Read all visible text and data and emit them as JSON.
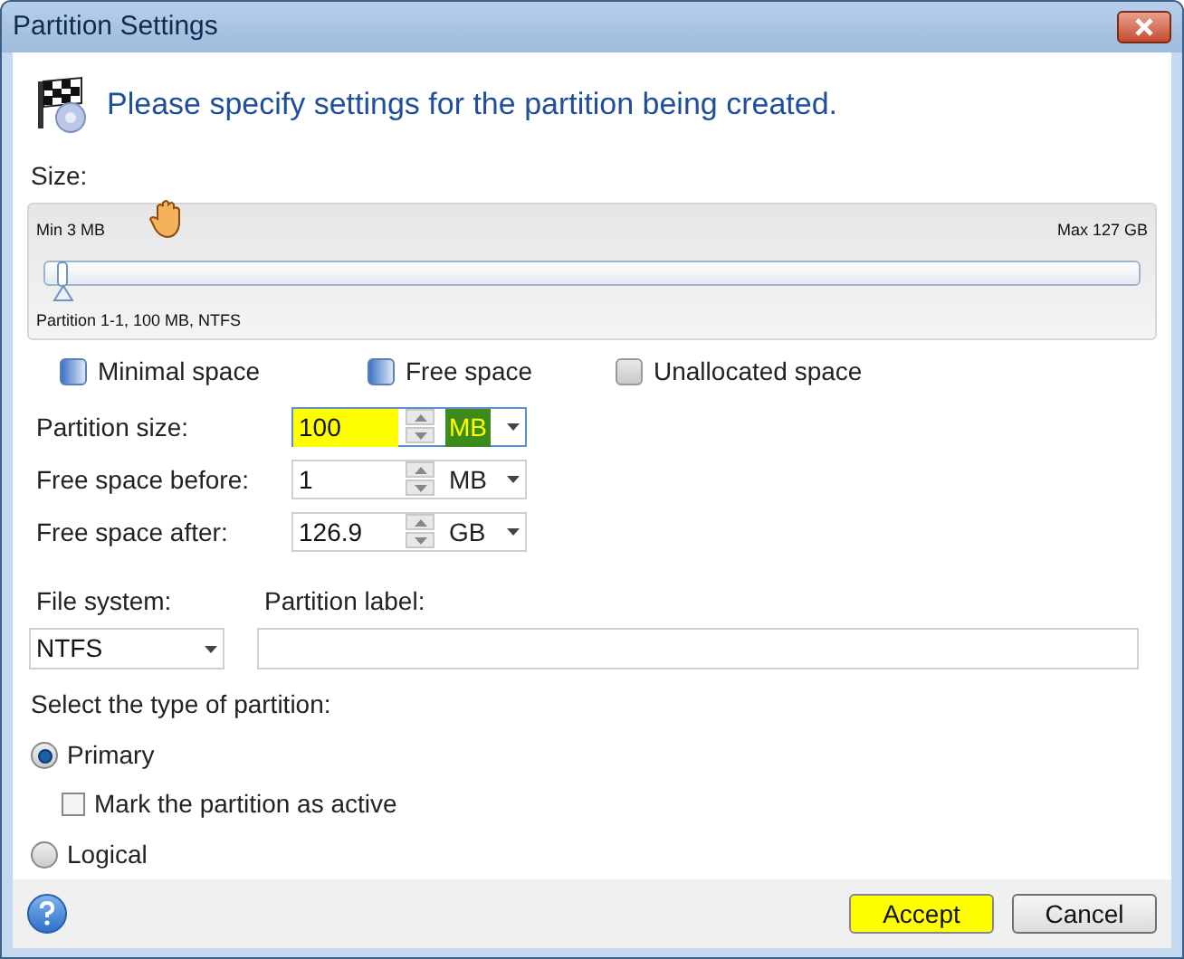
{
  "window": {
    "title": "Partition Settings"
  },
  "header": {
    "text": "Please specify settings for the partition being created."
  },
  "size": {
    "label": "Size:",
    "min": "Min 3 MB",
    "max": "Max 127 GB",
    "level": 0.01,
    "caption": "Partition 1-1, 100 MB, NTFS"
  },
  "space_toggles": [
    {
      "label": "Minimal space",
      "checked": true
    },
    {
      "label": "Free space",
      "checked": true
    },
    {
      "label": "Unallocated space",
      "checked": false
    }
  ],
  "size_fields": [
    {
      "label": "Partition size:",
      "value": "100",
      "unit": "MB",
      "focused": true,
      "highlighted": true
    },
    {
      "label": "Free space before:",
      "value": "1",
      "unit": "MB",
      "focused": false,
      "highlighted": false
    },
    {
      "label": "Free space after:",
      "value": "126.9",
      "unit": "GB",
      "focused": false,
      "highlighted": false
    }
  ],
  "file_system": {
    "label": "File system:",
    "value": "NTFS"
  },
  "partition_label": {
    "label": "Partition label:"
  },
  "partition_type": {
    "label": "Select the type of partition:",
    "options": [
      {
        "label": "Primary",
        "selected": true,
        "active_checkbox": {
          "label": "Mark the partition as active",
          "checked": false
        }
      },
      {
        "label": "Logical",
        "selected": false
      }
    ]
  },
  "buttons": [
    {
      "label": "Accept",
      "highlighted": true
    },
    {
      "label": "Cancel",
      "highlighted": false
    }
  ]
}
